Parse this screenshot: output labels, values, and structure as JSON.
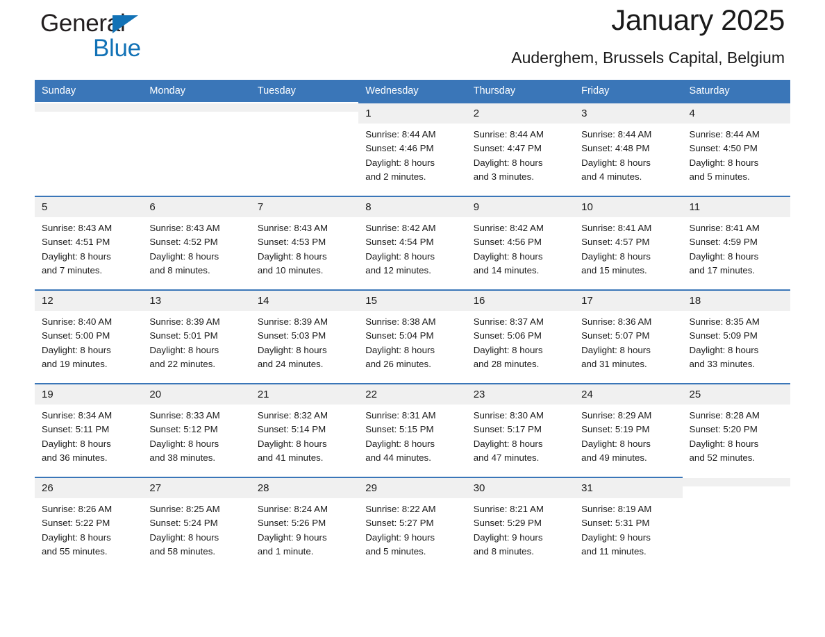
{
  "brand": {
    "name_part1": "General",
    "name_part2": "Blue",
    "logo_icon": "triangle-icon",
    "accent_color": "#1272b6"
  },
  "header": {
    "month_title": "January 2025",
    "location": "Auderghem, Brussels Capital, Belgium",
    "header_bg_color": "#3a76b8"
  },
  "weekday_headers": [
    "Sunday",
    "Monday",
    "Tuesday",
    "Wednesday",
    "Thursday",
    "Friday",
    "Saturday"
  ],
  "labels": {
    "sunrise_prefix": "Sunrise:",
    "sunset_prefix": "Sunset:",
    "daylight_prefix": "Daylight:"
  },
  "weeks": [
    [
      {
        "day": "",
        "empty": true
      },
      {
        "day": "",
        "empty": true
      },
      {
        "day": "",
        "empty": true
      },
      {
        "day": "1",
        "sunrise": "Sunrise: 8:44 AM",
        "sunset": "Sunset: 4:46 PM",
        "daylight_line1": "Daylight: 8 hours",
        "daylight_line2": "and 2 minutes."
      },
      {
        "day": "2",
        "sunrise": "Sunrise: 8:44 AM",
        "sunset": "Sunset: 4:47 PM",
        "daylight_line1": "Daylight: 8 hours",
        "daylight_line2": "and 3 minutes."
      },
      {
        "day": "3",
        "sunrise": "Sunrise: 8:44 AM",
        "sunset": "Sunset: 4:48 PM",
        "daylight_line1": "Daylight: 8 hours",
        "daylight_line2": "and 4 minutes."
      },
      {
        "day": "4",
        "sunrise": "Sunrise: 8:44 AM",
        "sunset": "Sunset: 4:50 PM",
        "daylight_line1": "Daylight: 8 hours",
        "daylight_line2": "and 5 minutes."
      }
    ],
    [
      {
        "day": "5",
        "sunrise": "Sunrise: 8:43 AM",
        "sunset": "Sunset: 4:51 PM",
        "daylight_line1": "Daylight: 8 hours",
        "daylight_line2": "and 7 minutes."
      },
      {
        "day": "6",
        "sunrise": "Sunrise: 8:43 AM",
        "sunset": "Sunset: 4:52 PM",
        "daylight_line1": "Daylight: 8 hours",
        "daylight_line2": "and 8 minutes."
      },
      {
        "day": "7",
        "sunrise": "Sunrise: 8:43 AM",
        "sunset": "Sunset: 4:53 PM",
        "daylight_line1": "Daylight: 8 hours",
        "daylight_line2": "and 10 minutes."
      },
      {
        "day": "8",
        "sunrise": "Sunrise: 8:42 AM",
        "sunset": "Sunset: 4:54 PM",
        "daylight_line1": "Daylight: 8 hours",
        "daylight_line2": "and 12 minutes."
      },
      {
        "day": "9",
        "sunrise": "Sunrise: 8:42 AM",
        "sunset": "Sunset: 4:56 PM",
        "daylight_line1": "Daylight: 8 hours",
        "daylight_line2": "and 14 minutes."
      },
      {
        "day": "10",
        "sunrise": "Sunrise: 8:41 AM",
        "sunset": "Sunset: 4:57 PM",
        "daylight_line1": "Daylight: 8 hours",
        "daylight_line2": "and 15 minutes."
      },
      {
        "day": "11",
        "sunrise": "Sunrise: 8:41 AM",
        "sunset": "Sunset: 4:59 PM",
        "daylight_line1": "Daylight: 8 hours",
        "daylight_line2": "and 17 minutes."
      }
    ],
    [
      {
        "day": "12",
        "sunrise": "Sunrise: 8:40 AM",
        "sunset": "Sunset: 5:00 PM",
        "daylight_line1": "Daylight: 8 hours",
        "daylight_line2": "and 19 minutes."
      },
      {
        "day": "13",
        "sunrise": "Sunrise: 8:39 AM",
        "sunset": "Sunset: 5:01 PM",
        "daylight_line1": "Daylight: 8 hours",
        "daylight_line2": "and 22 minutes."
      },
      {
        "day": "14",
        "sunrise": "Sunrise: 8:39 AM",
        "sunset": "Sunset: 5:03 PM",
        "daylight_line1": "Daylight: 8 hours",
        "daylight_line2": "and 24 minutes."
      },
      {
        "day": "15",
        "sunrise": "Sunrise: 8:38 AM",
        "sunset": "Sunset: 5:04 PM",
        "daylight_line1": "Daylight: 8 hours",
        "daylight_line2": "and 26 minutes."
      },
      {
        "day": "16",
        "sunrise": "Sunrise: 8:37 AM",
        "sunset": "Sunset: 5:06 PM",
        "daylight_line1": "Daylight: 8 hours",
        "daylight_line2": "and 28 minutes."
      },
      {
        "day": "17",
        "sunrise": "Sunrise: 8:36 AM",
        "sunset": "Sunset: 5:07 PM",
        "daylight_line1": "Daylight: 8 hours",
        "daylight_line2": "and 31 minutes."
      },
      {
        "day": "18",
        "sunrise": "Sunrise: 8:35 AM",
        "sunset": "Sunset: 5:09 PM",
        "daylight_line1": "Daylight: 8 hours",
        "daylight_line2": "and 33 minutes."
      }
    ],
    [
      {
        "day": "19",
        "sunrise": "Sunrise: 8:34 AM",
        "sunset": "Sunset: 5:11 PM",
        "daylight_line1": "Daylight: 8 hours",
        "daylight_line2": "and 36 minutes."
      },
      {
        "day": "20",
        "sunrise": "Sunrise: 8:33 AM",
        "sunset": "Sunset: 5:12 PM",
        "daylight_line1": "Daylight: 8 hours",
        "daylight_line2": "and 38 minutes."
      },
      {
        "day": "21",
        "sunrise": "Sunrise: 8:32 AM",
        "sunset": "Sunset: 5:14 PM",
        "daylight_line1": "Daylight: 8 hours",
        "daylight_line2": "and 41 minutes."
      },
      {
        "day": "22",
        "sunrise": "Sunrise: 8:31 AM",
        "sunset": "Sunset: 5:15 PM",
        "daylight_line1": "Daylight: 8 hours",
        "daylight_line2": "and 44 minutes."
      },
      {
        "day": "23",
        "sunrise": "Sunrise: 8:30 AM",
        "sunset": "Sunset: 5:17 PM",
        "daylight_line1": "Daylight: 8 hours",
        "daylight_line2": "and 47 minutes."
      },
      {
        "day": "24",
        "sunrise": "Sunrise: 8:29 AM",
        "sunset": "Sunset: 5:19 PM",
        "daylight_line1": "Daylight: 8 hours",
        "daylight_line2": "and 49 minutes."
      },
      {
        "day": "25",
        "sunrise": "Sunrise: 8:28 AM",
        "sunset": "Sunset: 5:20 PM",
        "daylight_line1": "Daylight: 8 hours",
        "daylight_line2": "and 52 minutes."
      }
    ],
    [
      {
        "day": "26",
        "sunrise": "Sunrise: 8:26 AM",
        "sunset": "Sunset: 5:22 PM",
        "daylight_line1": "Daylight: 8 hours",
        "daylight_line2": "and 55 minutes."
      },
      {
        "day": "27",
        "sunrise": "Sunrise: 8:25 AM",
        "sunset": "Sunset: 5:24 PM",
        "daylight_line1": "Daylight: 8 hours",
        "daylight_line2": "and 58 minutes."
      },
      {
        "day": "28",
        "sunrise": "Sunrise: 8:24 AM",
        "sunset": "Sunset: 5:26 PM",
        "daylight_line1": "Daylight: 9 hours",
        "daylight_line2": "and 1 minute."
      },
      {
        "day": "29",
        "sunrise": "Sunrise: 8:22 AM",
        "sunset": "Sunset: 5:27 PM",
        "daylight_line1": "Daylight: 9 hours",
        "daylight_line2": "and 5 minutes."
      },
      {
        "day": "30",
        "sunrise": "Sunrise: 8:21 AM",
        "sunset": "Sunset: 5:29 PM",
        "daylight_line1": "Daylight: 9 hours",
        "daylight_line2": "and 8 minutes."
      },
      {
        "day": "31",
        "sunrise": "Sunrise: 8:19 AM",
        "sunset": "Sunset: 5:31 PM",
        "daylight_line1": "Daylight: 9 hours",
        "daylight_line2": "and 11 minutes."
      },
      {
        "day": "",
        "empty": true
      }
    ]
  ]
}
